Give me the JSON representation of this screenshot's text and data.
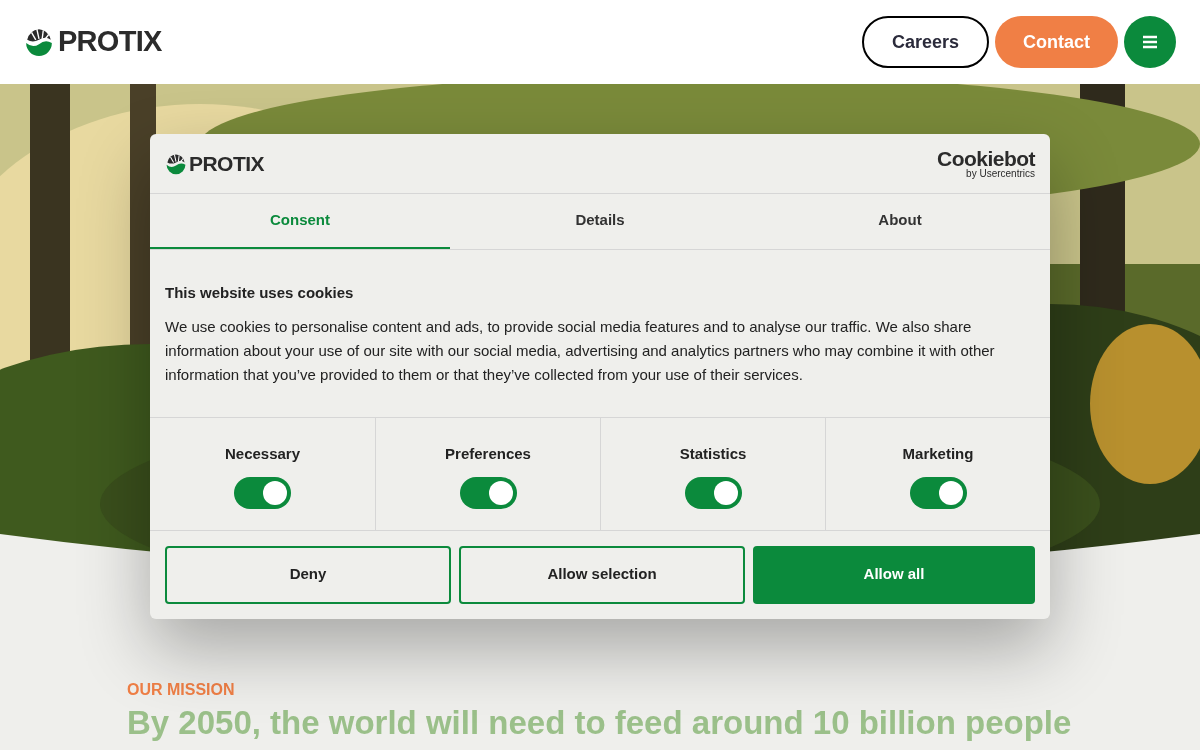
{
  "header": {
    "logo": "PROTIX",
    "buttons": [
      {
        "kind": "outline",
        "label": "Careers"
      },
      {
        "kind": "filled",
        "label": "Contact"
      }
    ]
  },
  "mission": {
    "eyebrow": "OUR MISSION",
    "headline": "By 2050, the world will need to feed around 10 billion people"
  },
  "cookie_dialog": {
    "logo": "PROTIX",
    "provider": "Cookiebot",
    "provider_sub": "by Usercentrics",
    "tabs": [
      {
        "label": "Consent",
        "selected": true
      },
      {
        "label": "Details",
        "selected": false
      },
      {
        "label": "About",
        "selected": false
      }
    ],
    "heading": "This website uses cookies",
    "body": "We use cookies to personalise content and ads, to provide social media features and to analyse our traffic. We also share information about your use of our site with our social media, advertising and analytics partners who may combine it with other information that you’ve provided to them or that they’ve collected from your use of their services.",
    "categories": [
      {
        "label": "Necessary",
        "checked": true
      },
      {
        "label": "Preferences",
        "checked": true
      },
      {
        "label": "Statistics",
        "checked": true
      },
      {
        "label": "Marketing",
        "checked": true
      }
    ],
    "buttons": [
      {
        "kind": "outline",
        "label": "Deny"
      },
      {
        "kind": "outline",
        "label": "Allow selection"
      },
      {
        "kind": "filled",
        "label": "Allow all"
      }
    ]
  }
}
